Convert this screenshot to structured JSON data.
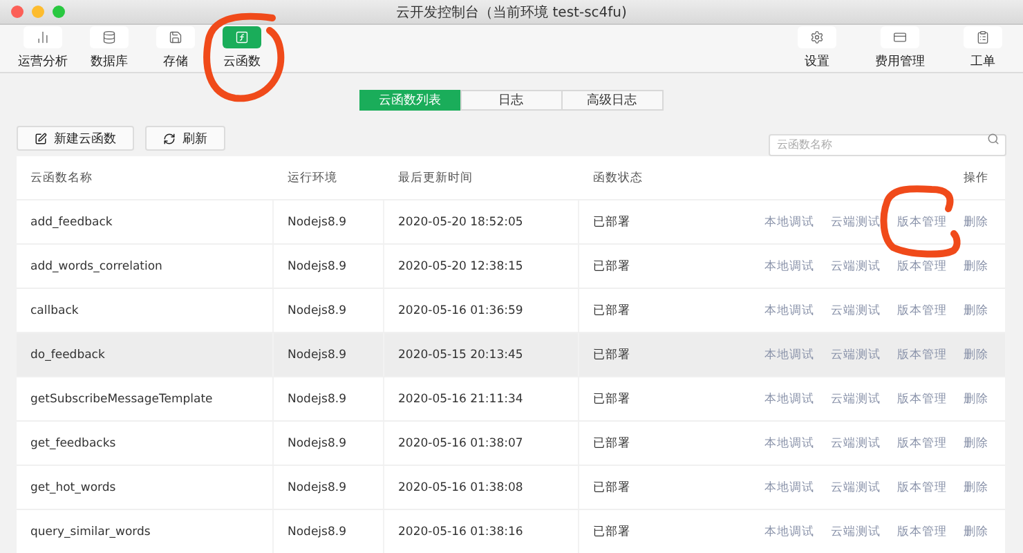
{
  "window": {
    "title": "云开发控制台（当前环境 test-sc4fu)"
  },
  "toolbar_left": [
    {
      "label": "运营分析",
      "selected": false
    },
    {
      "label": "数据库",
      "selected": false
    },
    {
      "label": "存储",
      "selected": false
    },
    {
      "label": "云函数",
      "selected": true
    }
  ],
  "toolbar_right": [
    {
      "label": "设置"
    },
    {
      "label": "费用管理"
    },
    {
      "label": "工单"
    }
  ],
  "tabs": [
    {
      "label": "云函数列表",
      "selected": true
    },
    {
      "label": "日志",
      "selected": false
    },
    {
      "label": "高级日志",
      "selected": false
    }
  ],
  "actions": [
    {
      "label": "新建云函数"
    },
    {
      "label": "刷新"
    }
  ],
  "search": {
    "placeholder": "云函数名称"
  },
  "table": {
    "columns": [
      "云函数名称",
      "运行环境",
      "最后更新时间",
      "函数状态",
      "操作"
    ],
    "rows": [
      {
        "name": "add_feedback",
        "runtime": "Nodejs8.9",
        "updated": "2020-05-20 18:52:05",
        "status": "已部署",
        "hovered": false,
        "actions": [
          "本地调试",
          "云端测试",
          "版本管理",
          "删除"
        ]
      },
      {
        "name": "add_words_correlation",
        "runtime": "Nodejs8.9",
        "updated": "2020-05-20 12:38:15",
        "status": "已部署",
        "hovered": false,
        "actions": [
          "本地调试",
          "云端测试",
          "版本管理",
          "删除"
        ]
      },
      {
        "name": "callback",
        "runtime": "Nodejs8.9",
        "updated": "2020-05-16 01:36:59",
        "status": "已部署",
        "hovered": false,
        "actions": [
          "本地调试",
          "云端测试",
          "版本管理",
          "删除"
        ]
      },
      {
        "name": "do_feedback",
        "runtime": "Nodejs8.9",
        "updated": "2020-05-15 20:13:45",
        "status": "已部署",
        "hovered": true,
        "actions": [
          "本地调试",
          "云端测试",
          "版本管理",
          "删除"
        ]
      },
      {
        "name": "getSubscribeMessageTemplate",
        "runtime": "Nodejs8.9",
        "updated": "2020-05-16 21:11:34",
        "status": "已部署",
        "hovered": false,
        "actions": [
          "本地调试",
          "云端测试",
          "版本管理",
          "删除"
        ]
      },
      {
        "name": "get_feedbacks",
        "runtime": "Nodejs8.9",
        "updated": "2020-05-16 01:38:07",
        "status": "已部署",
        "hovered": false,
        "actions": [
          "本地调试",
          "云端测试",
          "版本管理",
          "删除"
        ]
      },
      {
        "name": "get_hot_words",
        "runtime": "Nodejs8.9",
        "updated": "2020-05-16 01:38:08",
        "status": "已部署",
        "hovered": false,
        "actions": [
          "本地调试",
          "云端测试",
          "版本管理",
          "删除"
        ]
      },
      {
        "name": "query_similar_words",
        "runtime": "Nodejs8.9",
        "updated": "2020-05-16 01:38:16",
        "status": "已部署",
        "hovered": false,
        "actions": [
          "本地调试",
          "云端测试",
          "版本管理",
          "删除"
        ]
      }
    ]
  }
}
